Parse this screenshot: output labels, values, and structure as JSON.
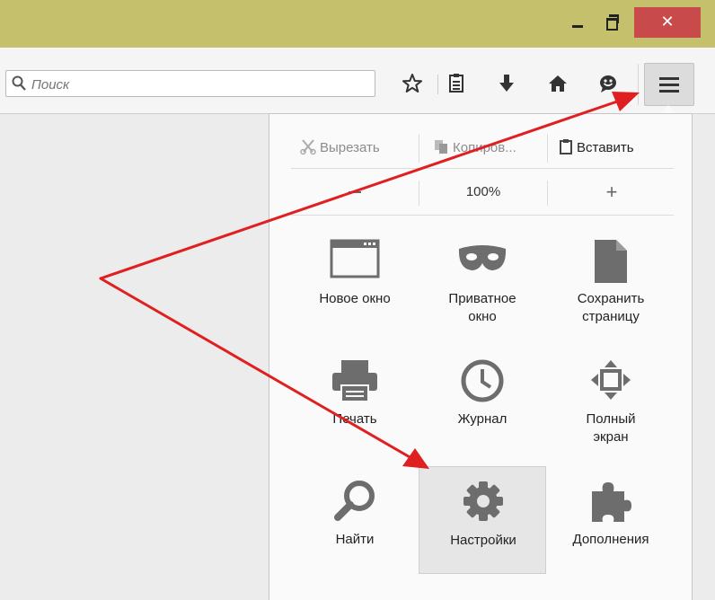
{
  "search": {
    "placeholder": "Поиск"
  },
  "edit": {
    "cut": "Вырезать",
    "copy": "Копиров...",
    "paste": "Вставить"
  },
  "zoom": {
    "level": "100%",
    "in": "+"
  },
  "tiles": [
    {
      "label": "Новое окно",
      "icon": "window-icon"
    },
    {
      "label": "Приватное\nокно",
      "icon": "mask-icon"
    },
    {
      "label": "Сохранить\nстраницу",
      "icon": "page-icon"
    },
    {
      "label": "Печать",
      "icon": "printer-icon"
    },
    {
      "label": "Журнал",
      "icon": "clock-icon"
    },
    {
      "label": "Полный\nэкран",
      "icon": "fullscreen-icon"
    },
    {
      "label": "Найти",
      "icon": "magnifier-icon"
    },
    {
      "label": "Настройки",
      "icon": "gear-icon"
    },
    {
      "label": "Дополнения",
      "icon": "puzzle-icon"
    }
  ],
  "colors": {
    "titlebar": "#c4c06b",
    "close_button": "#c94a4a",
    "annotation_arrow": "#e02020",
    "icon_gray": "#6d6d6d"
  }
}
